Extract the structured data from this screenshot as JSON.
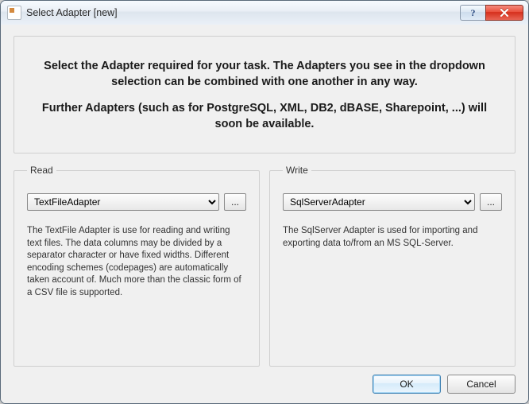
{
  "window": {
    "title": "Select Adapter [new]"
  },
  "intro": {
    "headline": "Select the Adapter required for your task. The Adapters you see in the dropdown selection can be combined with one another in any way.",
    "subline": "Further Adapters (such as for PostgreSQL, XML, DB2, dBASE, Sharepoint, ...) will soon be available."
  },
  "read": {
    "legend": "Read",
    "selected": "TextFileAdapter",
    "ellipsis": "...",
    "description": "The TextFile Adapter is use for reading and writing text files. The data columns may be divided by a separator character or have fixed widths. Different encoding schemes (codepages) are automatically taken account of. Much more than the classic form of a CSV file is supported."
  },
  "write": {
    "legend": "Write",
    "selected": "SqlServerAdapter",
    "ellipsis": "...",
    "description": "The SqlServer Adapter is used for importing and exporting data to/from an MS SQL-Server."
  },
  "buttons": {
    "ok": "OK",
    "cancel": "Cancel"
  }
}
